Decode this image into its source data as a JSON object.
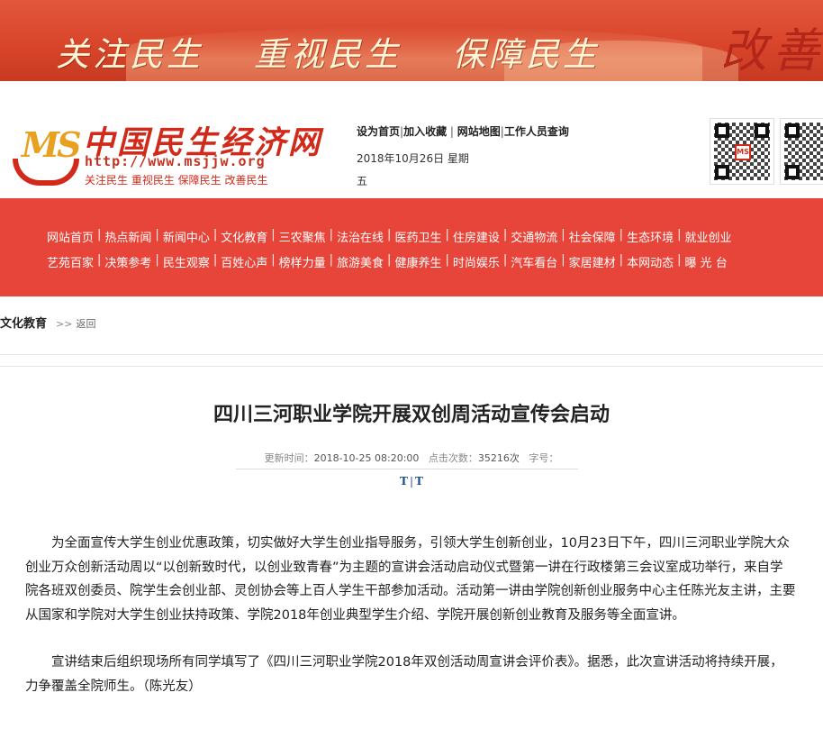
{
  "banner": {
    "slogans": [
      "关注民生",
      "重视民生",
      "保障民生"
    ],
    "big_text": "改善"
  },
  "logo": {
    "emblem": "MS",
    "name": "中国民生经济网",
    "url": "http://www.msjjw.org",
    "tagline": "关注民生 重视民生 保障民生 改善民生"
  },
  "toplinks": {
    "set_home": "设为首页",
    "favorite": "加入收藏",
    "sitemap": "网站地图",
    "staff_query": "工作人员查询"
  },
  "date_line": {
    "date": "2018年10月26日 星期",
    "weekday": "五"
  },
  "nav": {
    "row1": [
      "网站首页",
      "热点新闻",
      "新闻中心",
      "文化教育",
      "三农聚焦",
      "法治在线",
      "医药卫生",
      "住房建设",
      "交通物流",
      "社会保障",
      "生态环境",
      "就业创业"
    ],
    "row2": [
      "艺苑百家",
      "决策参考",
      "民生观察",
      "百姓心声",
      "榜样力量",
      "旅游美食",
      "健康养生",
      "时尚娱乐",
      "汽车看台",
      "家居建材",
      "本网动态",
      "曝 光 台"
    ]
  },
  "breadcrumb": {
    "section": "文化教育",
    "arrows": ">>",
    "back": "返回"
  },
  "article": {
    "title": "四川三河职业学院开展双创周活动宣传会启动",
    "meta": {
      "update_label": "更新时间：",
      "update_value": "2018-10-25 08:20:00",
      "clicks_label": "点击次数：",
      "clicks_value": "35216次",
      "fontsize_label": "字号："
    },
    "fontsize_big": "T",
    "fontsize_small": "T",
    "paragraphs": [
      "为全面宣传大学生创业优惠政策，切实做好大学生创业指导服务，引领大学生创新创业，10月23日下午，四川三河职业学院大众创业万众创新活动周以“以创新致时代，以创业致青春”为主题的宣讲会活动启动仪式暨第一讲在行政楼第三会议室成功举行，来自学院各班双创委员、院学生会创业部、灵创协会等上百人学生干部参加活动。活动第一讲由学院创新创业服务中心主任陈光友主讲，主要从国家和学院对大学生创业扶持政策、学院2018年创业典型学生介绍、学院开展创新创业教育及服务等全面宣讲。",
      "宣讲结束后组织现场所有同学填写了《四川三河职业学院2018年双创活动周宣讲会评价表》。据悉，此次宣讲活动将持续开展，力争覆盖全院师生。（陈光友）"
    ]
  },
  "colors": {
    "nav_bg": "#e8453a",
    "brand_red": "#d22a1a",
    "link_blue": "#1a4d8c"
  }
}
